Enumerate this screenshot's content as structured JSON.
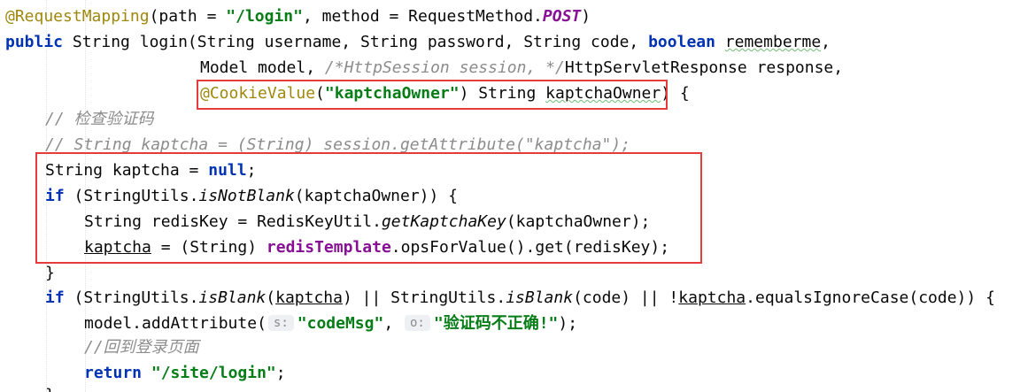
{
  "code": {
    "l1": {
      "ann": "@RequestMapping",
      "p1": "(path = ",
      "s1": "\"/login\"",
      "p2": ", method = RequestMethod.",
      "c1": "POST",
      "p3": ")"
    },
    "l2": {
      "k1": "public",
      "p1": " String login(String username, String password, String code, ",
      "k2": "boolean",
      "p2": " ",
      "v1": "rememberme",
      "p3": ","
    },
    "l3": {
      "p1": "Model model, ",
      "c1": "/*HttpSession session, */",
      "v1": "HttpServletResponse",
      "p2": " response,"
    },
    "l4": {
      "ann": "@CookieValue",
      "p1": "(",
      "s1": "\"kaptchaOwner\"",
      "p2": ") String ",
      "v1": "kaptchaOwner",
      "p3": ") {"
    },
    "l5": {
      "c1": "// 检查验证码"
    },
    "l6": {
      "c1": "// String kaptcha = (String) session.getAttribute(\"kaptcha\");"
    },
    "l7": {
      "p1": "String kaptcha = ",
      "k1": "null",
      "p2": ";"
    },
    "l8": {
      "k1": "if",
      "p1": " (StringUtils.",
      "m1": "isNotBlank",
      "p2": "(kaptchaOwner)) {"
    },
    "l9": {
      "p1": "String redisKey = RedisKeyUtil.",
      "m1": "getKaptchaKey",
      "p2": "(kaptchaOwner);"
    },
    "l10": {
      "v1": "kaptcha",
      "p1": " = (String) ",
      "f1": "redisTemplate",
      "p2": ".opsForValue().get(redisKey);"
    },
    "l11": {
      "p1": "}"
    },
    "l12": {
      "k1": "if",
      "p1": " (StringUtils.",
      "m1": "isBlank",
      "p2": "(",
      "v1": "kaptcha",
      "p3": ") || StringUtils.",
      "m2": "isBlank",
      "p4": "(code) || !",
      "v2": "kaptcha",
      "p5": ".equalsIgnoreCase(code)) {"
    },
    "l13": {
      "p1": "model.addAttribute(",
      "h1": "s:",
      "s1": "\"codeMsg\"",
      "p2": ", ",
      "h2": "o:",
      "s2": "\"验证码不正确!\"",
      "p3": ");"
    },
    "l14": {
      "c1": "//回到登录页面"
    },
    "l15": {
      "k1": "return",
      "p1": " ",
      "s1": "\"/site/login\"",
      "p2": ";"
    },
    "l16": {
      "p1": "}"
    }
  }
}
